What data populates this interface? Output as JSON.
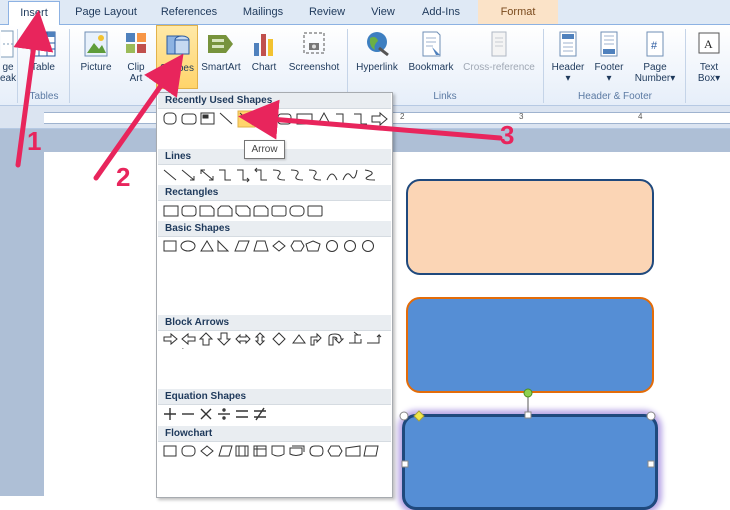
{
  "tabs": [
    {
      "label": "Insert",
      "active": true
    },
    {
      "label": "Page Layout"
    },
    {
      "label": "References"
    },
    {
      "label": "Mailings"
    },
    {
      "label": "Review"
    },
    {
      "label": "View"
    },
    {
      "label": "Add-Ins"
    },
    {
      "label": "Format",
      "contextual": true
    }
  ],
  "ribbon": {
    "partial_left": {
      "line1": "ge",
      "line2": "eak"
    },
    "table": {
      "label": "Table",
      "group": "Tables"
    },
    "picture": "Picture",
    "clipart": {
      "line1": "Clip",
      "line2": "Art"
    },
    "shapes": "Shapes",
    "smartart": "SmartArt",
    "chart": "Chart",
    "screenshot": "Screenshot",
    "hyperlink": "Hyperlink",
    "bookmark": "Bookmark",
    "crossref": "Cross-reference",
    "links_group": "Links",
    "header": "Header",
    "footer": "Footer",
    "pagenumber": {
      "line1": "Page",
      "line2": "Number"
    },
    "hf_group": "Header & Footer",
    "textbox": {
      "line1": "Text",
      "line2": "Box"
    }
  },
  "ruler": {
    "numbers": [
      "2",
      "3",
      "4"
    ]
  },
  "gallery": {
    "sections": [
      "Recently Used Shapes",
      "Lines",
      "Rectangles",
      "Basic Shapes",
      "Block Arrows",
      "Equation Shapes",
      "Flowchart"
    ],
    "tooltip": "Arrow"
  },
  "annotations": {
    "n1": "1",
    "n2": "2",
    "n3": "3"
  },
  "colors": {
    "accent_pink": "#e8255c",
    "peach_box": "#fbd5b5",
    "blue_box": "#558ed5",
    "orange_border": "#e36c09",
    "dark_blue": "#1f497d"
  }
}
